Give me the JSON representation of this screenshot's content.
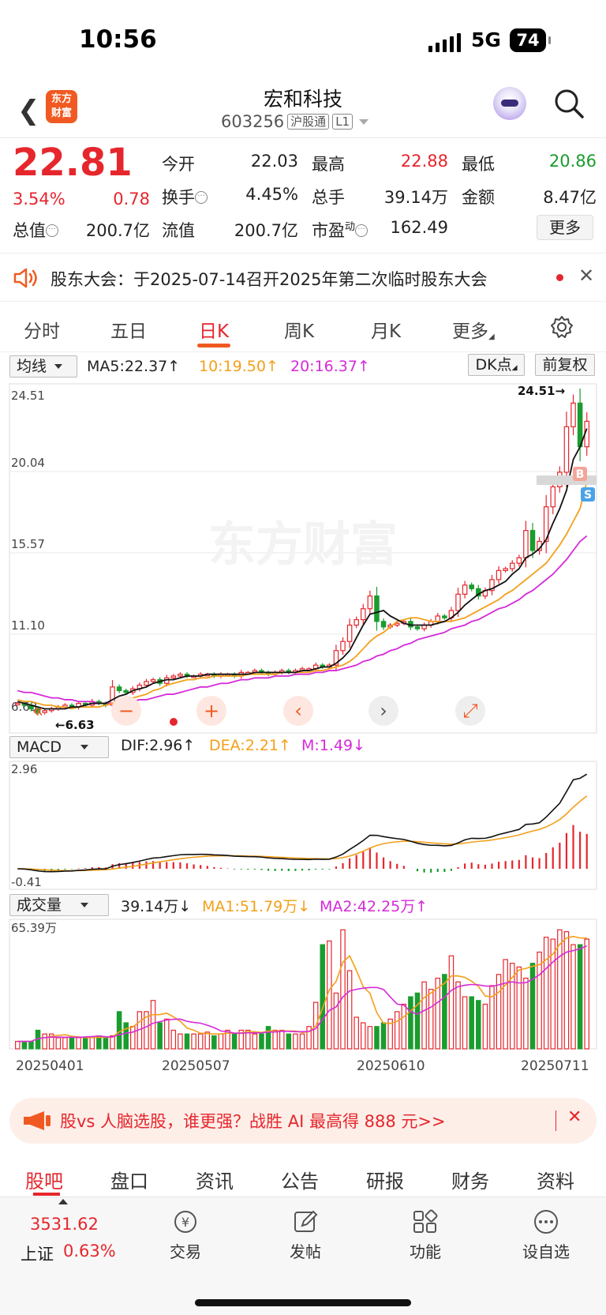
{
  "status": {
    "time": "10:56",
    "network": "5G",
    "battery": "74"
  },
  "header": {
    "title": "宏和科技",
    "code": "603256",
    "tag1": "沪股通",
    "tag2": "L1",
    "logo": "东方\n财富"
  },
  "quote": {
    "price": "22.81",
    "change_pct": "3.54%",
    "change": "0.78",
    "open_label": "今开",
    "open": "22.03",
    "high_label": "最高",
    "high": "22.88",
    "low_label": "最低",
    "low": "20.86",
    "turnover_label": "换手",
    "turnover": "4.45%",
    "volume_label": "总手",
    "volume": "39.14万",
    "amount_label": "金额",
    "amount": "8.47亿",
    "mktcap_label": "总值",
    "mktcap": "200.7亿",
    "float_label": "流值",
    "float": "200.7亿",
    "pe_label": "市盈",
    "pe_sup": "动",
    "pe": "162.49",
    "more": "更多"
  },
  "notice": {
    "text": "股东大会：于2025-07-14召开2025年第二次临时股东大会"
  },
  "tabs": [
    "分时",
    "五日",
    "日K",
    "周K",
    "月K",
    "更多"
  ],
  "indicators": {
    "ma_select": "均线",
    "ma5": "MA5:22.37↑",
    "ma10": "10:19.50↑",
    "ma20": "20:16.37↑",
    "dk": "DK点",
    "fq": "前复权",
    "macd_select": "MACD",
    "dif": "DIF:2.96↑",
    "dea": "DEA:2.21↑",
    "m": "M:1.49↓",
    "vol_select": "成交量",
    "vol": "39.14万↓",
    "ma1": "MA1:51.79万↓",
    "ma2": "MA2:42.25万↑"
  },
  "chart_data": {
    "type": "candlestick",
    "price_axis_labels": [
      "24.51",
      "20.04",
      "15.57",
      "11.10",
      "6.63"
    ],
    "max_marker": "24.51→",
    "min_marker": "←6.63",
    "macd_axis_labels": [
      "2.96",
      "-0.41"
    ],
    "volume_axis_labels": [
      "65.39万"
    ],
    "dates": [
      "20250401",
      "20250507",
      "20250610",
      "20250711"
    ],
    "watermark": "东方财富",
    "closes": [
      7.3,
      7.2,
      7.0,
      6.8,
      6.9,
      7.0,
      7.1,
      7.2,
      7.1,
      7.3,
      7.2,
      7.4,
      7.3,
      7.2,
      8.2,
      8.0,
      7.9,
      8.1,
      8.3,
      8.5,
      8.6,
      8.4,
      8.7,
      8.8,
      8.9,
      8.8,
      8.8,
      8.9,
      8.9,
      8.8,
      8.9,
      8.9,
      8.8,
      9.0,
      9.0,
      9.1,
      9.0,
      8.9,
      9.0,
      9.1,
      9.0,
      9.1,
      9.2,
      9.2,
      9.4,
      9.3,
      9.4,
      10.2,
      10.7,
      11.6,
      11.9,
      12.5,
      13.2,
      11.8,
      11.5,
      11.6,
      11.7,
      11.8,
      11.5,
      11.4,
      11.6,
      11.8,
      12.1,
      12.0,
      12.4,
      13.3,
      13.8,
      13.6,
      13.2,
      13.5,
      14.1,
      14.6,
      14.7,
      15.0,
      15.3,
      16.8,
      15.7,
      16.2,
      18.1,
      19.2,
      20.0,
      22.5,
      23.8,
      21.4,
      22.8
    ],
    "volumes": [
      4,
      4,
      4,
      10,
      8,
      8,
      6,
      6,
      6,
      6,
      6,
      6,
      7,
      6,
      7,
      20,
      14,
      12,
      20,
      20,
      26,
      14,
      16,
      10,
      8,
      8,
      8,
      8,
      9,
      7,
      8,
      10,
      8,
      10,
      10,
      8,
      8,
      12,
      10,
      10,
      8,
      8,
      8,
      12,
      25,
      56,
      58,
      30,
      64,
      42,
      17,
      14,
      12,
      12,
      14,
      16,
      20,
      24,
      28,
      30,
      36,
      32,
      38,
      40,
      50,
      36,
      28,
      28,
      26,
      24,
      34,
      40,
      48,
      46,
      44,
      38,
      46,
      52,
      60,
      59,
      64,
      63,
      56,
      56,
      59
    ],
    "ma5": [
      7.4,
      7.3,
      7.2,
      7.1,
      7.0,
      7.0,
      7.0,
      7.0,
      7.1,
      7.1,
      7.2,
      7.3,
      7.3,
      7.3,
      7.5,
      7.7,
      7.8,
      8.0,
      8.1,
      8.2,
      8.4,
      8.5,
      8.6,
      8.6,
      8.7,
      8.8,
      8.8,
      8.8,
      8.9,
      8.9,
      8.9,
      8.9,
      8.9,
      8.9,
      8.9,
      9.0,
      9.0,
      9.0,
      9.0,
      9.0,
      9.0,
      9.0,
      9.1,
      9.1,
      9.2,
      9.3,
      9.3,
      9.5,
      9.8,
      10.2,
      10.9,
      11.6,
      12.2,
      12.3,
      12.4,
      12.1,
      11.9,
      11.7,
      11.6,
      11.6,
      11.6,
      11.6,
      11.7,
      11.8,
      12.0,
      12.3,
      12.7,
      13.0,
      13.3,
      13.5,
      13.6,
      13.8,
      14.0,
      14.4,
      14.7,
      15.3,
      15.5,
      15.8,
      16.3,
      17.2,
      18.0,
      19.0,
      20.7,
      21.4,
      22.4
    ],
    "ma10": [
      7.5,
      7.4,
      7.4,
      7.3,
      7.2,
      7.2,
      7.1,
      7.1,
      7.0,
      7.1,
      7.1,
      7.1,
      7.1,
      7.2,
      7.3,
      7.4,
      7.5,
      7.6,
      7.7,
      7.8,
      8.0,
      8.1,
      8.3,
      8.4,
      8.5,
      8.6,
      8.6,
      8.7,
      8.7,
      8.8,
      8.8,
      8.8,
      8.8,
      8.8,
      8.9,
      8.9,
      8.9,
      8.9,
      8.9,
      9.0,
      9.0,
      9.0,
      9.0,
      9.0,
      9.1,
      9.1,
      9.2,
      9.3,
      9.4,
      9.6,
      9.9,
      10.3,
      10.7,
      11.0,
      11.2,
      11.5,
      11.8,
      11.9,
      12.0,
      12.0,
      11.9,
      11.8,
      11.8,
      11.8,
      11.8,
      11.9,
      12.0,
      12.2,
      12.4,
      12.6,
      12.8,
      13.0,
      13.3,
      13.5,
      13.8,
      14.1,
      14.4,
      14.7,
      15.0,
      15.5,
      16.0,
      16.6,
      17.3,
      18.0,
      19.5
    ],
    "ma20": [
      8.0,
      7.9,
      7.9,
      7.8,
      7.7,
      7.6,
      7.6,
      7.5,
      7.5,
      7.4,
      7.4,
      7.4,
      7.3,
      7.3,
      7.3,
      7.3,
      7.4,
      7.4,
      7.5,
      7.5,
      7.6,
      7.7,
      7.8,
      7.8,
      7.9,
      8.0,
      8.1,
      8.2,
      8.2,
      8.3,
      8.4,
      8.4,
      8.5,
      8.6,
      8.6,
      8.7,
      8.7,
      8.7,
      8.8,
      8.8,
      8.8,
      8.9,
      8.9,
      8.9,
      9.0,
      9.0,
      9.1,
      9.1,
      9.2,
      9.3,
      9.4,
      9.6,
      9.7,
      9.9,
      10.0,
      10.2,
      10.3,
      10.5,
      10.6,
      10.8,
      10.9,
      11.0,
      11.1,
      11.2,
      11.4,
      11.5,
      11.6,
      11.8,
      11.9,
      12.1,
      12.3,
      12.5,
      12.6,
      12.8,
      13.0,
      13.3,
      13.5,
      13.8,
      14.1,
      14.4,
      14.8,
      15.2,
      15.7,
      16.2,
      16.5
    ]
  },
  "banner": {
    "text": "股vs 人脑选股，谁更强？战胜 AI 最高得 888 元>>"
  },
  "bottom_tabs": [
    "股吧",
    "盘口",
    "资讯",
    "公告",
    "研报",
    "财务",
    "资料"
  ],
  "bottom_bar": {
    "index_value": "3531.62",
    "index_name": "上证",
    "index_pct": "0.63%",
    "trade": "交易",
    "post": "发帖",
    "func": "功能",
    "watch": "设自选"
  },
  "colors": {
    "up": "#e6262d",
    "down": "#1a9c2e",
    "ma10": "#f3a01a",
    "ma20": "#d62ad8",
    "brand": "#f05a22"
  }
}
